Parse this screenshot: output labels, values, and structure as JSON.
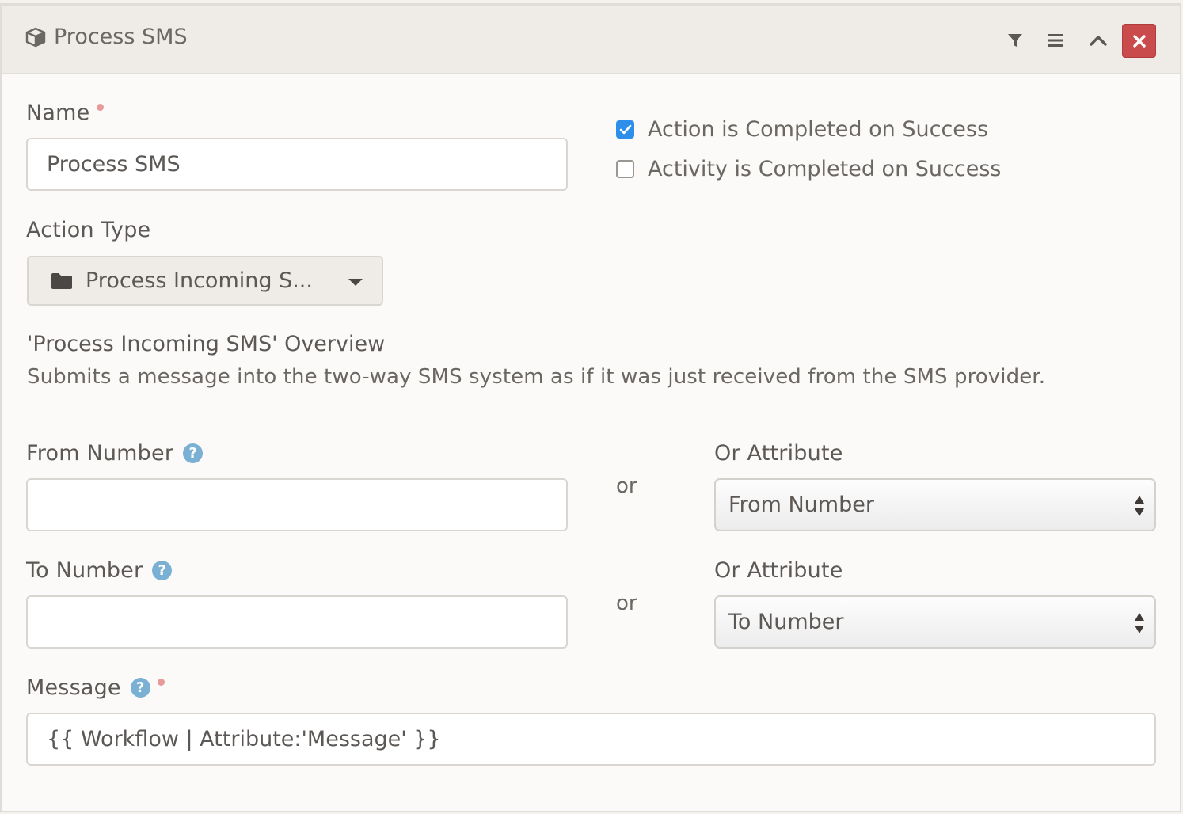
{
  "header": {
    "title": "Process SMS",
    "icons": [
      "cube-icon",
      "filter-icon",
      "menu-icon",
      "chevron-up-icon",
      "close-icon"
    ]
  },
  "name": {
    "label": "Name",
    "value": "Process SMS"
  },
  "checkboxes": [
    {
      "label": "Action is Completed on Success",
      "checked": true
    },
    {
      "label": "Activity is Completed on Success",
      "checked": false
    }
  ],
  "action_type": {
    "label": "Action Type",
    "value": "Process Incoming S..."
  },
  "overview": {
    "title": "'Process Incoming SMS' Overview",
    "description": "Submits a message into the two-way SMS system as if it was just received from the SMS provider."
  },
  "from_number": {
    "label": "From Number",
    "value": "",
    "or_text": "or",
    "attr_label": "Or Attribute",
    "attr_value": "From Number"
  },
  "to_number": {
    "label": "To Number",
    "value": "",
    "or_text": "or",
    "attr_label": "Or Attribute",
    "attr_value": "To Number"
  },
  "message": {
    "label": "Message",
    "value": "{{ Workflow | Attribute:'Message' }}"
  },
  "colors": {
    "accent": "#2e8fea",
    "danger": "#c94b4b",
    "help": "#7ab0d3",
    "required": "#e89a9a"
  }
}
